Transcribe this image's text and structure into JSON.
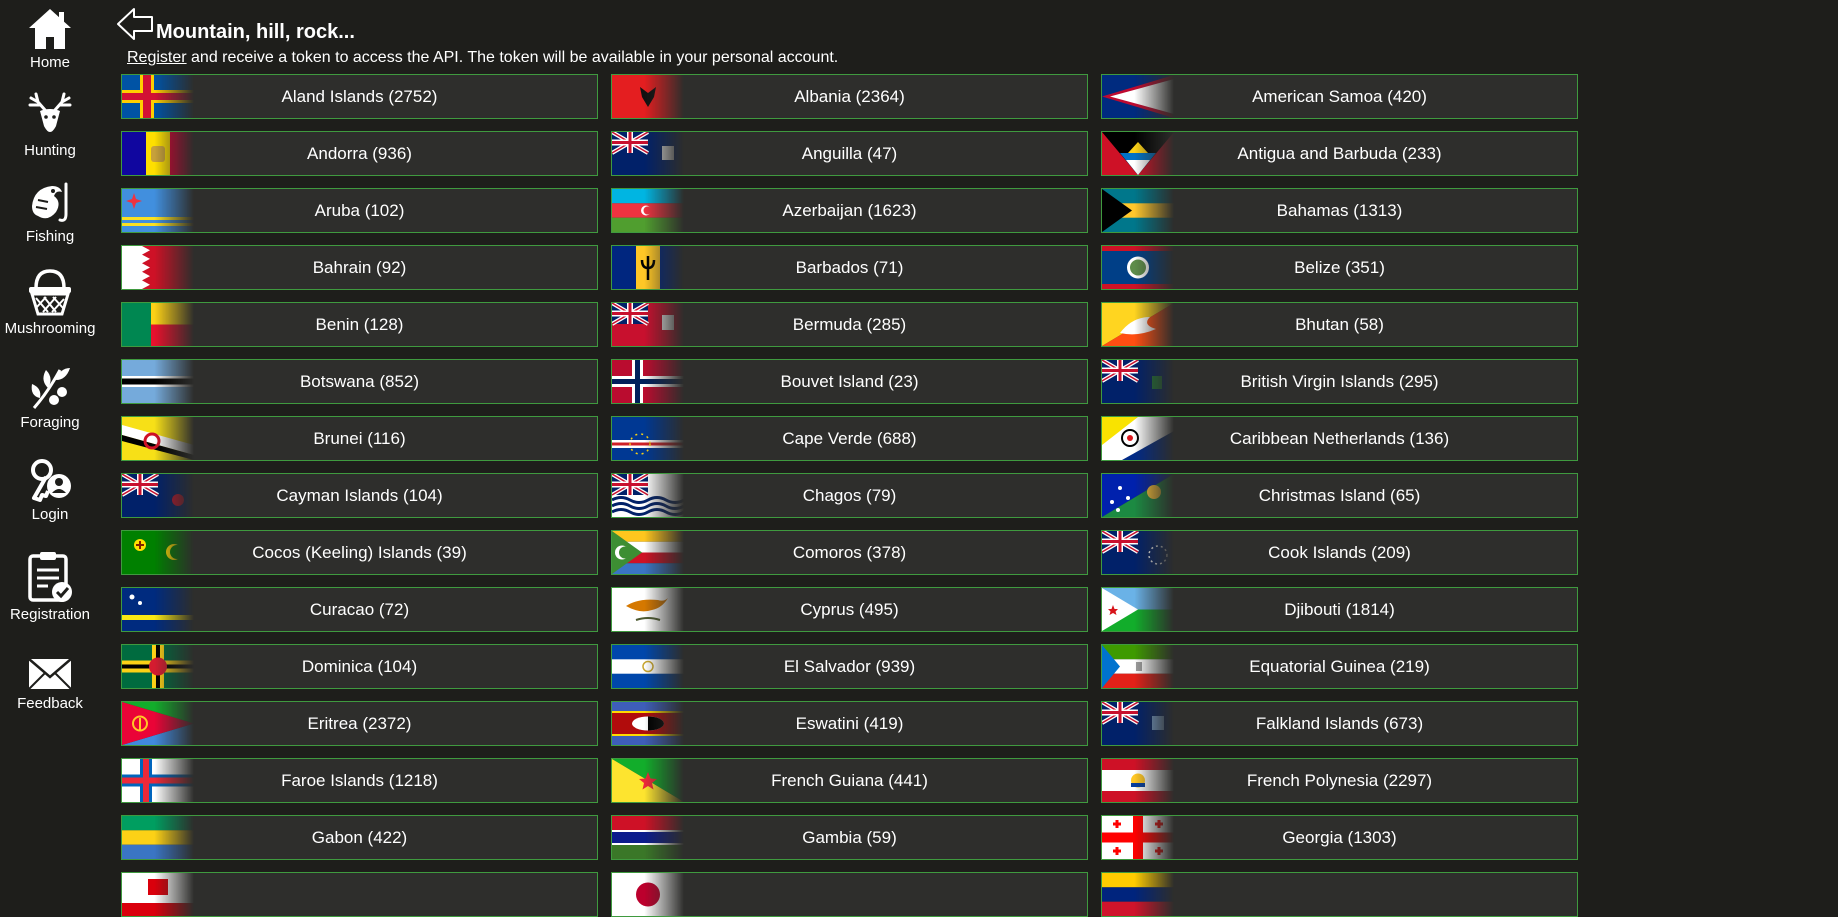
{
  "nav": [
    {
      "name": "home",
      "label": "Home",
      "icon": "house-icon"
    },
    {
      "name": "hunting",
      "label": "Hunting",
      "icon": "deer-head-icon"
    },
    {
      "name": "fishing",
      "label": "Fishing",
      "icon": "fish-hook-icon"
    },
    {
      "name": "mushrooming",
      "label": "Mushrooming",
      "icon": "basket-icon"
    },
    {
      "name": "foraging",
      "label": "Foraging",
      "icon": "berry-branch-icon"
    },
    {
      "name": "login",
      "label": "Login",
      "icon": "key-user-icon"
    },
    {
      "name": "registration",
      "label": "Registration",
      "icon": "clipboard-check-icon"
    },
    {
      "name": "feedback",
      "label": "Feedback",
      "icon": "envelope-icon"
    }
  ],
  "header": {
    "title": "Mountain, hill, rock...",
    "register_link": "Register",
    "register_text": " and receive a token to access the API. The token will be available in your personal account."
  },
  "colors": {
    "background": "#1e1e1b",
    "tile": "#2e2e2c",
    "tile_border": "#3f9a3f"
  },
  "countries": [
    {
      "name": "Aland Islands",
      "count": 2752,
      "label": "Aland Islands (2752)"
    },
    {
      "name": "Albania",
      "count": 2364,
      "label": "Albania (2364)"
    },
    {
      "name": "American Samoa",
      "count": 420,
      "label": "American Samoa (420)"
    },
    {
      "name": "Andorra",
      "count": 936,
      "label": "Andorra (936)"
    },
    {
      "name": "Anguilla",
      "count": 47,
      "label": "Anguilla (47)"
    },
    {
      "name": "Antigua and Barbuda",
      "count": 233,
      "label": "Antigua and Barbuda (233)"
    },
    {
      "name": "Aruba",
      "count": 102,
      "label": "Aruba (102)"
    },
    {
      "name": "Azerbaijan",
      "count": 1623,
      "label": "Azerbaijan (1623)"
    },
    {
      "name": "Bahamas",
      "count": 1313,
      "label": "Bahamas (1313)"
    },
    {
      "name": "Bahrain",
      "count": 92,
      "label": "Bahrain (92)"
    },
    {
      "name": "Barbados",
      "count": 71,
      "label": "Barbados (71)"
    },
    {
      "name": "Belize",
      "count": 351,
      "label": "Belize (351)"
    },
    {
      "name": "Benin",
      "count": 128,
      "label": "Benin (128)"
    },
    {
      "name": "Bermuda",
      "count": 285,
      "label": "Bermuda (285)"
    },
    {
      "name": "Bhutan",
      "count": 58,
      "label": "Bhutan (58)"
    },
    {
      "name": "Botswana",
      "count": 852,
      "label": "Botswana (852)"
    },
    {
      "name": "Bouvet Island",
      "count": 23,
      "label": "Bouvet Island (23)"
    },
    {
      "name": "British Virgin Islands",
      "count": 295,
      "label": "British Virgin Islands (295)"
    },
    {
      "name": "Brunei",
      "count": 116,
      "label": "Brunei (116)"
    },
    {
      "name": "Cape Verde",
      "count": 688,
      "label": "Cape Verde (688)"
    },
    {
      "name": "Caribbean Netherlands",
      "count": 136,
      "label": "Caribbean Netherlands (136)"
    },
    {
      "name": "Cayman Islands",
      "count": 104,
      "label": "Cayman Islands (104)"
    },
    {
      "name": "Chagos",
      "count": 79,
      "label": "Chagos (79)"
    },
    {
      "name": "Christmas Island",
      "count": 65,
      "label": "Christmas Island (65)"
    },
    {
      "name": "Cocos (Keeling) Islands",
      "count": 39,
      "label": "Cocos (Keeling) Islands (39)"
    },
    {
      "name": "Comoros",
      "count": 378,
      "label": "Comoros (378)"
    },
    {
      "name": "Cook Islands",
      "count": 209,
      "label": "Cook Islands (209)"
    },
    {
      "name": "Curacao",
      "count": 72,
      "label": "Curacao (72)"
    },
    {
      "name": "Cyprus",
      "count": 495,
      "label": "Cyprus (495)"
    },
    {
      "name": "Djibouti",
      "count": 1814,
      "label": "Djibouti (1814)"
    },
    {
      "name": "Dominica",
      "count": 104,
      "label": "Dominica (104)"
    },
    {
      "name": "El Salvador",
      "count": 939,
      "label": "El Salvador (939)"
    },
    {
      "name": "Equatorial Guinea",
      "count": 219,
      "label": "Equatorial Guinea (219)"
    },
    {
      "name": "Eritrea",
      "count": 2372,
      "label": "Eritrea (2372)"
    },
    {
      "name": "Eswatini",
      "count": 419,
      "label": "Eswatini (419)"
    },
    {
      "name": "Falkland Islands",
      "count": 673,
      "label": "Falkland Islands (673)"
    },
    {
      "name": "Faroe Islands",
      "count": 1218,
      "label": "Faroe Islands (1218)"
    },
    {
      "name": "French Guiana",
      "count": 441,
      "label": "French Guiana (441)"
    },
    {
      "name": "French Polynesia",
      "count": 2297,
      "label": "French Polynesia (2297)"
    },
    {
      "name": "Gabon",
      "count": 422,
      "label": "Gabon (422)"
    },
    {
      "name": "Gambia",
      "count": 59,
      "label": "Gambia (59)"
    },
    {
      "name": "Georgia",
      "count": 1303,
      "label": "Georgia (1303)"
    },
    {
      "name": "Gibraltar",
      "count": null,
      "label": ""
    },
    {
      "name": "Japan",
      "count": null,
      "label": ""
    },
    {
      "name": "Venezuela",
      "count": null,
      "label": ""
    }
  ]
}
